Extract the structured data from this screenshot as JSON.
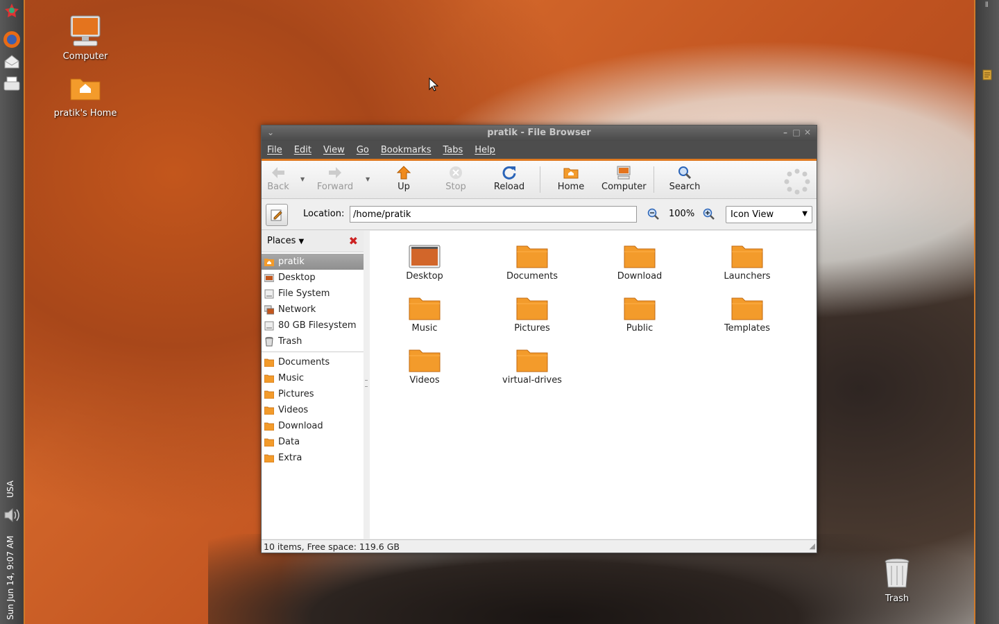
{
  "desktop": {
    "icons": [
      {
        "label": "Computer"
      },
      {
        "label": "pratik's Home"
      },
      {
        "label": "Trash"
      }
    ]
  },
  "panel": {
    "clock": "Sun Jun 14,  9:07 AM",
    "keyboard": "USA"
  },
  "window": {
    "title": "pratik - File Browser",
    "menu": [
      "File",
      "Edit",
      "View",
      "Go",
      "Bookmarks",
      "Tabs",
      "Help"
    ],
    "toolbar": {
      "back": "Back",
      "forward": "Forward",
      "up": "Up",
      "stop": "Stop",
      "reload": "Reload",
      "home": "Home",
      "computer": "Computer",
      "search": "Search"
    },
    "location": {
      "label": "Location:",
      "value": "/home/pratik",
      "zoom": "100%",
      "view": "Icon View"
    },
    "sidebar": {
      "header": "Places",
      "places": [
        "pratik",
        "Desktop",
        "File System",
        "Network",
        "80 GB Filesystem",
        "Trash"
      ],
      "bookmarks": [
        "Documents",
        "Music",
        "Pictures",
        "Videos",
        "Download",
        "Data",
        "Extra"
      ]
    },
    "files": [
      "Desktop",
      "Documents",
      "Download",
      "Launchers",
      "Music",
      "Pictures",
      "Public",
      "Templates",
      "Videos",
      "virtual-drives"
    ],
    "status": "10 items, Free space: 119.6 GB"
  },
  "colors": {
    "accent": "#e07a20",
    "folder": "#f39b2b"
  }
}
